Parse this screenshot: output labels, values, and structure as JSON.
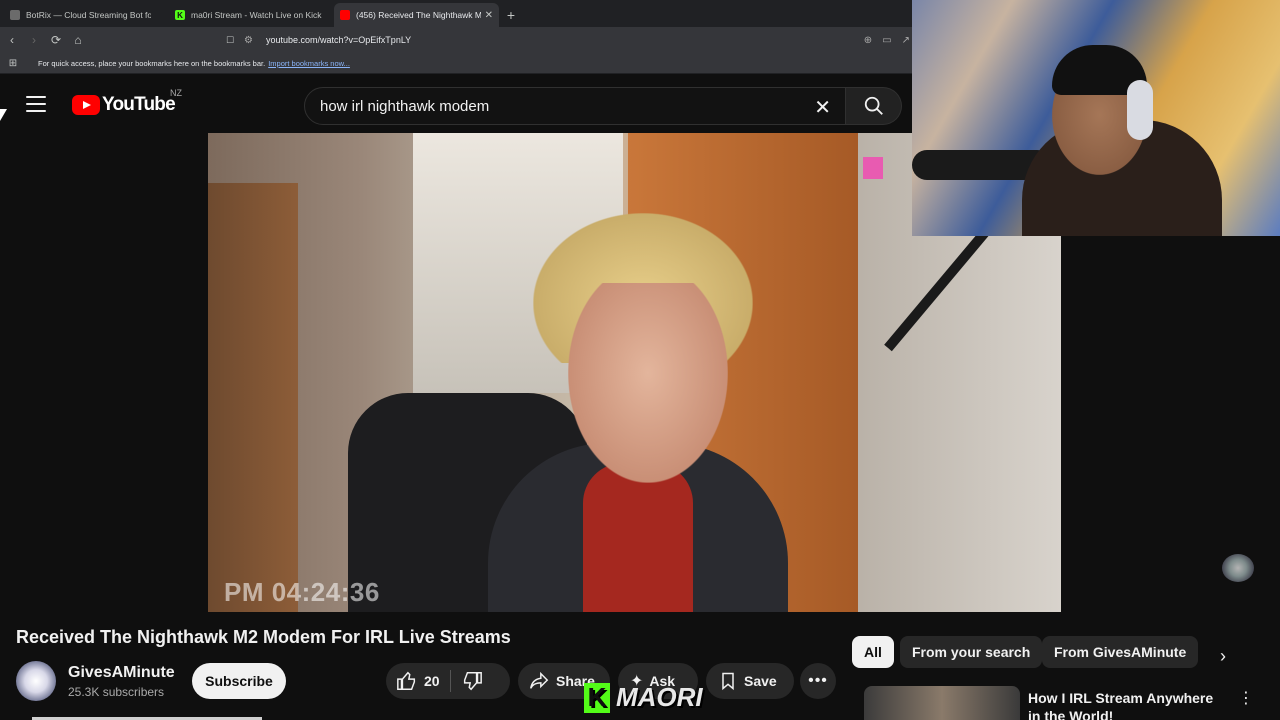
{
  "browser": {
    "tabs": [
      {
        "title": "BotRix — Cloud Streaming Bot for Tw",
        "active": false,
        "favicon_color": "#6b6b6b"
      },
      {
        "title": "ma0ri Stream - Watch Live on Kick",
        "active": false,
        "favicon_color": "#53fc18"
      },
      {
        "title": "(456) Received The Nighthawk M",
        "active": true,
        "favicon_color": "#ff0000"
      }
    ],
    "url": "youtube.com/watch?v=OpEifxTpnLY",
    "bookmarks_text": "For quick access, place your bookmarks here on the bookmarks bar.",
    "bookmarks_link": "Import bookmarks now..."
  },
  "youtube": {
    "logo_text": "YouTube",
    "country_code": "NZ",
    "search_query": "how irl nighthawk modem"
  },
  "video": {
    "timestamp_overlay": "PM 04:24:36",
    "title": "Received The Nighthawk M2 Modem For IRL Live Streams",
    "channel": "GivesAMinute",
    "subscribers": "25.3K subscribers",
    "subscribe_label": "Subscribe",
    "likes": "20",
    "share_label": "Share",
    "ask_label": "Ask",
    "save_label": "Save"
  },
  "filters": {
    "chips": [
      "All",
      "From your search",
      "From GivesAMinute"
    ]
  },
  "recommendation": {
    "title": "How I IRL Stream Anywhere in the World!"
  },
  "watermark": {
    "text": "MAORI"
  },
  "colors": {
    "youtube_red": "#ff0000",
    "kick_green": "#53fc18",
    "background": "#0f0f0f",
    "pill_bg": "#272727"
  }
}
